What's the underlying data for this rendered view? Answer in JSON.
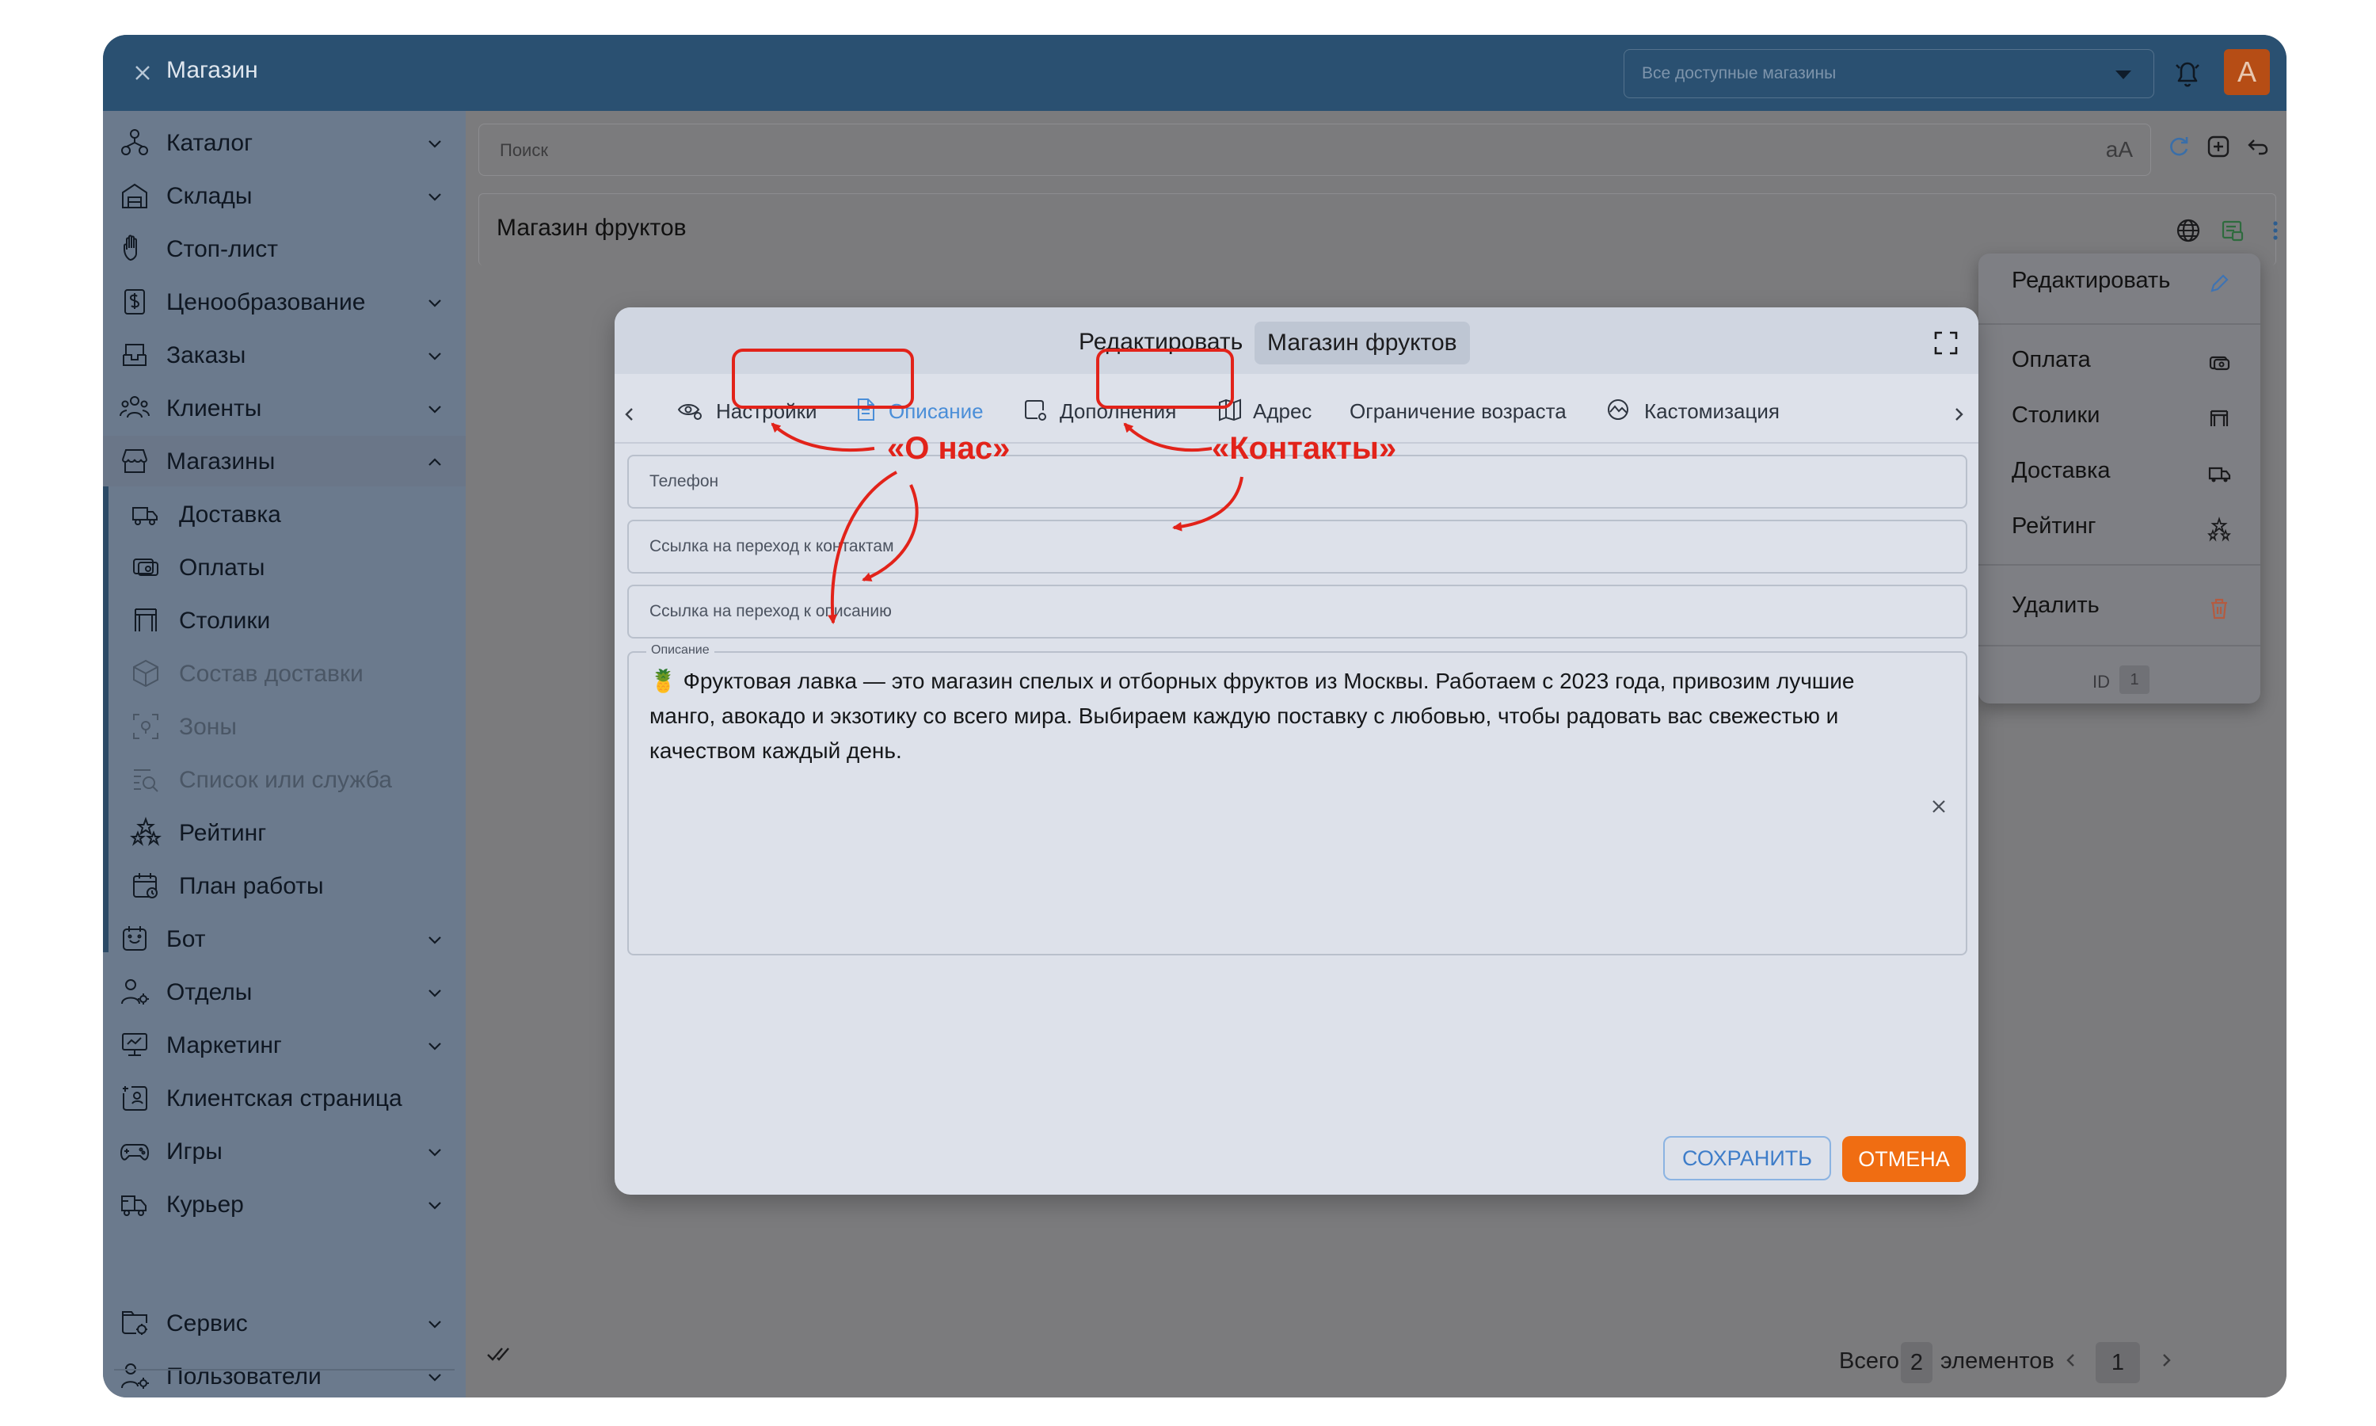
{
  "app": {
    "title": "Магазин",
    "store_select_placeholder": "Все доступные магазины",
    "avatar_letter": "A"
  },
  "sidebar": {
    "items": [
      {
        "label": "Каталог",
        "icon": "catalog-icon"
      },
      {
        "label": "Склады",
        "icon": "warehouse-icon"
      },
      {
        "label": "Стоп-лист",
        "icon": "hand-stop-icon"
      },
      {
        "label": "Ценообразование",
        "icon": "price-icon"
      },
      {
        "label": "Заказы",
        "icon": "orders-icon"
      },
      {
        "label": "Клиенты",
        "icon": "clients-icon"
      },
      {
        "label": "Магазины",
        "icon": "store-icon"
      },
      {
        "label": "Доставка",
        "icon": "delivery-truck-icon"
      },
      {
        "label": "Оплаты",
        "icon": "payment-icon"
      },
      {
        "label": "Столики",
        "icon": "table-icon"
      },
      {
        "label": "Состав доставки",
        "icon": "package-icon"
      },
      {
        "label": "Зоны",
        "icon": "zones-icon"
      },
      {
        "label": "Список или служба",
        "icon": "list-search-icon"
      },
      {
        "label": "Рейтинг",
        "icon": "rating-stars-icon"
      },
      {
        "label": "План работы",
        "icon": "calendar-icon"
      },
      {
        "label": "Бот",
        "icon": "bot-icon"
      },
      {
        "label": "Отделы",
        "icon": "departments-icon"
      },
      {
        "label": "Маркетинг",
        "icon": "marketing-icon"
      },
      {
        "label": "Клиентская страница",
        "icon": "client-page-icon"
      },
      {
        "label": "Игры",
        "icon": "gamepad-icon"
      },
      {
        "label": "Курьер",
        "icon": "courier-icon"
      },
      {
        "label": "Сервис",
        "icon": "service-icon"
      },
      {
        "label": "Пользователи",
        "icon": "users-icon"
      }
    ]
  },
  "toolbar": {
    "search_placeholder": "Поиск",
    "search_case_label": "aA"
  },
  "store_card": {
    "name": "Магазин фруктов"
  },
  "context_menu": {
    "items": [
      {
        "label": "Редактировать",
        "icon": "pencil-icon"
      },
      {
        "label": "Оплата",
        "icon": "payment-icon"
      },
      {
        "label": "Столики",
        "icon": "table-icon"
      },
      {
        "label": "Доставка",
        "icon": "delivery-truck-icon"
      },
      {
        "label": "Рейтинг",
        "icon": "rating-stars-icon"
      },
      {
        "label": "Удалить",
        "icon": "trash-icon"
      }
    ],
    "id_label": "ID",
    "id_value": "1"
  },
  "modal": {
    "title": "Редактировать",
    "title_chip": "Магазин фруктов",
    "tabs": [
      {
        "label": "Настройки",
        "icon": "settings-eye-icon"
      },
      {
        "label": "Описание",
        "icon": "document-icon"
      },
      {
        "label": "Дополнения",
        "icon": "additions-icon"
      },
      {
        "label": "Адрес",
        "icon": "map-icon"
      },
      {
        "label": "Ограничение возраста",
        "icon": ""
      },
      {
        "label": "Кастомизация",
        "icon": "customize-icon"
      }
    ],
    "active_tab": "Описание",
    "fields": {
      "phone_placeholder": "Телефон",
      "contacts_link_placeholder": "Ссылка на переход к контактам",
      "description_link_placeholder": "Ссылка на переход к описанию",
      "description_legend": "Описание",
      "description_value": "🍍 Фруктовая лавка — это магазин спелых и отборных фруктов из Москвы. Работаем с 2023 года, привозим лучшие манго, авокадо и экзотику со всего мира. Выбираем каждую поставку с любовью, чтобы радовать вас свежестью и качеством каждый день."
    },
    "save_label": "СОХРАНИТЬ",
    "cancel_label": "ОТМЕНА"
  },
  "pagination": {
    "total_label": "Всего",
    "total_value": "2",
    "elements_label": "элементов",
    "current_page": "1"
  },
  "annotations": {
    "about_label": "«О нас»",
    "contacts_label": "«Контакты»",
    "color": "#e2231a"
  }
}
